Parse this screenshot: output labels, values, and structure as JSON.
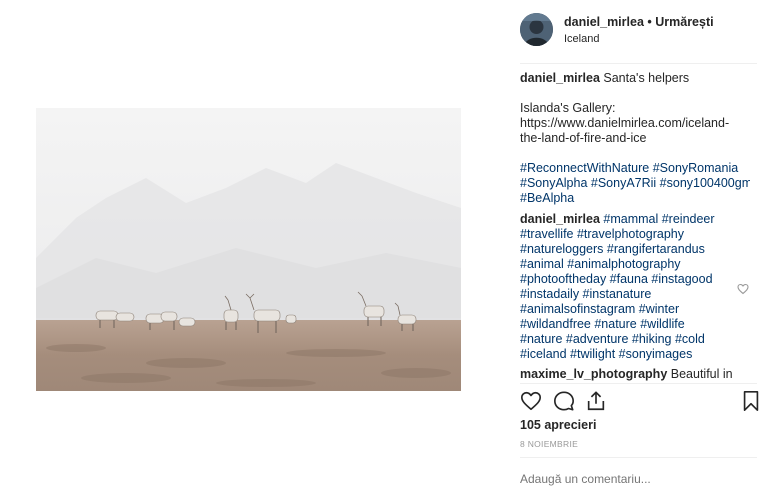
{
  "post": {
    "username": "daniel_mirlea",
    "separator": " • ",
    "follow_label": "Urmărești",
    "location": "Iceland",
    "caption_text": "Santa's helpers",
    "gallery_label": "Islanda's Gallery:",
    "gallery_url_lines": [
      "https://www.danielmirlea.com/iceland-",
      "the-land-of-fire-and-ice"
    ],
    "caption_hashtag_lines": [
      "#ReconnectWithNature #SonyRomania",
      "#SonyAlpha #SonyA7Rii #sony100400gm",
      "#BeAlpha"
    ],
    "comment_hashtags_first": "#mammal #reindeer",
    "comment_hashtag_lines": [
      "#travellife #travelphotography",
      "#natureloggers #rangifertarandus",
      "#animal #animalphotography",
      "#photooftheday #fauna #instagood",
      "#instadaily #instanature",
      "#animalsofinstagram #winter",
      "#wildandfree #nature #wildlife",
      "#nature #adventure #hiking #cold",
      "#iceland #twilight #sonyimages"
    ],
    "next_commenter": "maxime_lv_photography",
    "next_comment_text": "Beautiful in",
    "likes": "105 aprecieri",
    "date": "8 NOIEMBRIE",
    "comment_placeholder": "Adaugă un comentariu..."
  },
  "icons": [
    "heart-icon",
    "comment-icon",
    "share-icon",
    "bookmark-icon",
    "small-heart-icon"
  ],
  "colors": {
    "hashtag": "#003569",
    "text": "#262626",
    "muted": "#999999",
    "divider": "#efefef"
  }
}
